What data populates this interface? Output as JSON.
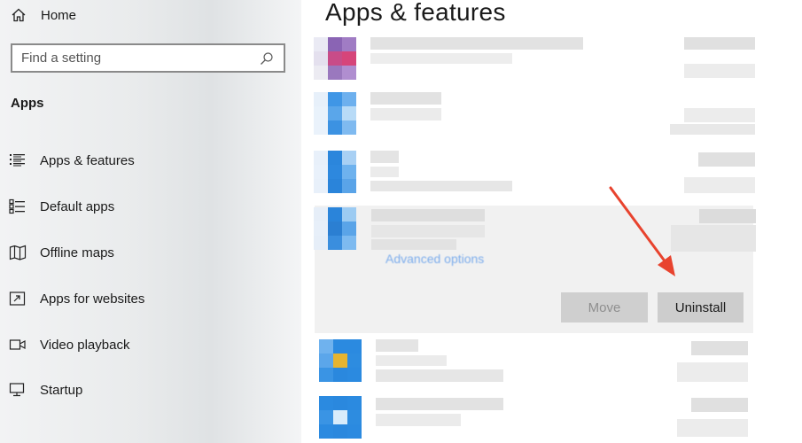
{
  "sidebar": {
    "home_label": "Home",
    "search_placeholder": "Find a setting",
    "section_title": "Apps",
    "items": [
      {
        "label": "Apps & features",
        "icon": "apps-features-icon"
      },
      {
        "label": "Default apps",
        "icon": "default-apps-icon"
      },
      {
        "label": "Offline maps",
        "icon": "offline-maps-icon"
      },
      {
        "label": "Apps for websites",
        "icon": "apps-websites-icon"
      },
      {
        "label": "Video playback",
        "icon": "video-playback-icon"
      },
      {
        "label": "Startup",
        "icon": "startup-icon"
      }
    ]
  },
  "main": {
    "title": "Apps & features",
    "selected_app": {
      "advanced_link": "Advanced options",
      "move_label": "Move",
      "uninstall_label": "Uninstall"
    }
  },
  "colors": {
    "accent": "#1a73e8",
    "arrow": "#e8432e",
    "app_icon_blue": "#2b8ae0",
    "app_icon_yellow": "#e6b430"
  }
}
